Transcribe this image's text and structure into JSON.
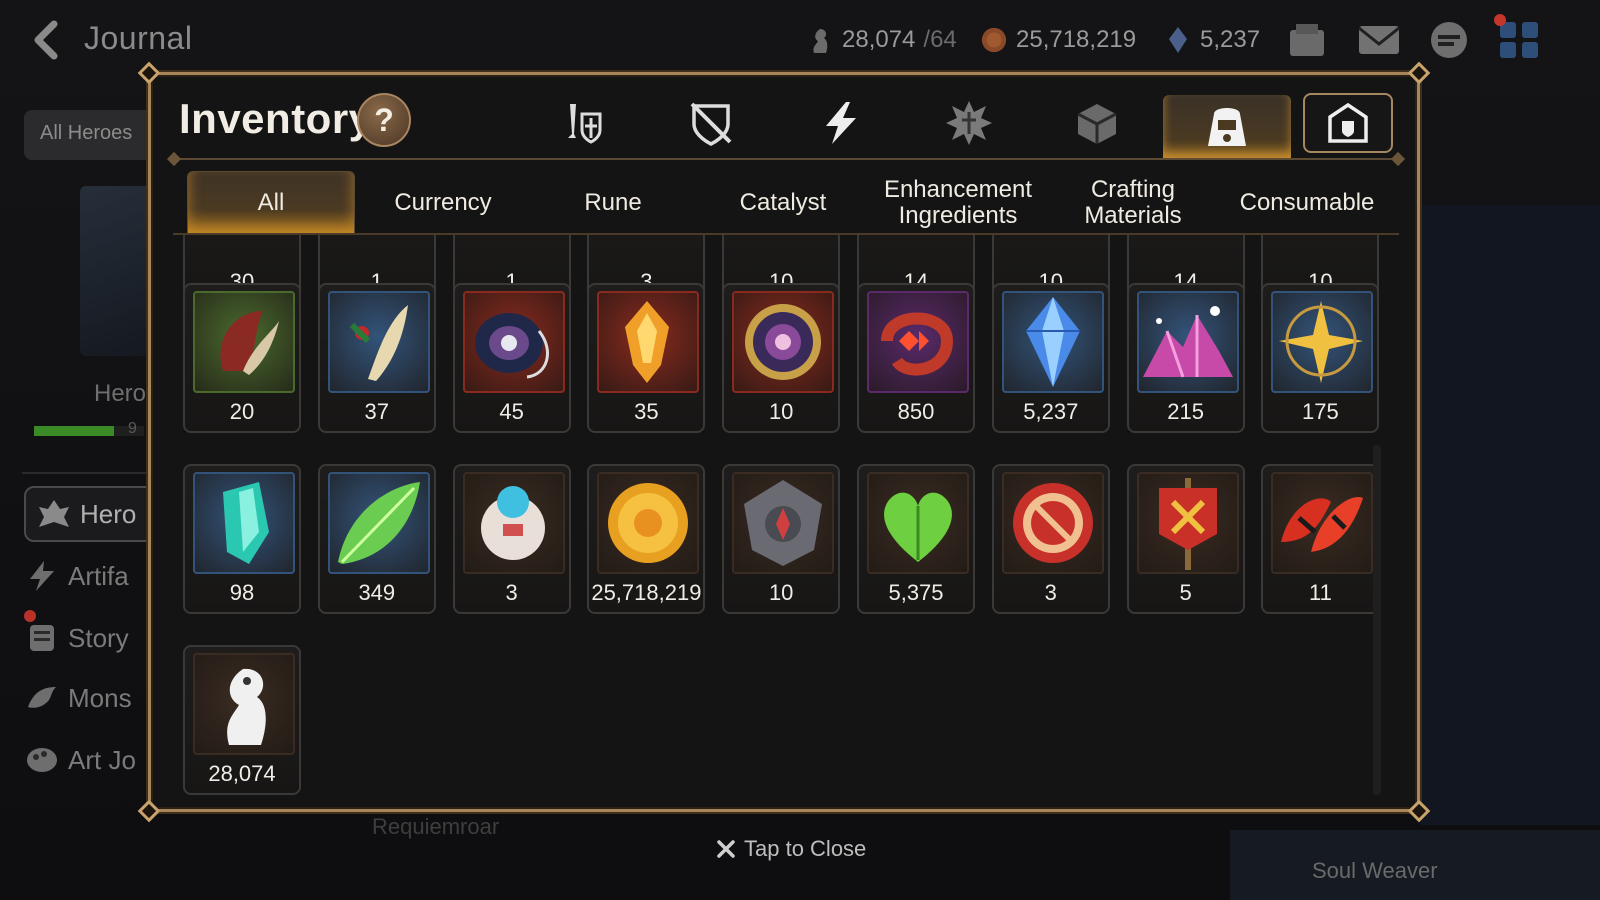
{
  "top_bar": {
    "title": "Journal",
    "skystone": "28,074",
    "skystone_cap": "/64",
    "gold": "25,718,219",
    "crystal": "5,237"
  },
  "left": {
    "filter": "All Heroes",
    "hero_caption": "Hero",
    "hero_bar_value": "9",
    "nav": [
      "Hero",
      "Artifa",
      "Story",
      "Mons",
      "Art Jo"
    ]
  },
  "modal": {
    "title": "Inventory",
    "help": "?",
    "category_tabs": [
      "weapon-armor-icon",
      "broken-shield-icon",
      "lightning-icon",
      "rune-crest-icon",
      "cube-icon",
      "bag-icon",
      "guild-shield-icon"
    ],
    "sub_tabs": [
      "All",
      "Currency",
      "Rune",
      "Catalyst",
      "Enhancement\nIngredients",
      "Crafting\nMaterials",
      "Consumable"
    ],
    "active_sub_tab": "All",
    "partial_row": [
      "30",
      "1",
      "1",
      "3",
      "10",
      "14",
      "10",
      "14",
      "10"
    ],
    "items": [
      {
        "icon": "claw-icon",
        "count": "20",
        "bg": "green"
      },
      {
        "icon": "feather-berry-icon",
        "count": "37",
        "bg": "blue"
      },
      {
        "icon": "crystal-disc-icon",
        "count": "45",
        "bg": "red"
      },
      {
        "icon": "flame-crystal-icon",
        "count": "35",
        "bg": "red"
      },
      {
        "icon": "ornate-orb-icon",
        "count": "10",
        "bg": "red"
      },
      {
        "icon": "red-charm-icon",
        "count": "850",
        "bg": "purple"
      },
      {
        "icon": "blue-crystal-icon",
        "count": "5,237",
        "bg": "blue"
      },
      {
        "icon": "pink-gem-pile-icon",
        "count": "215",
        "bg": "blue"
      },
      {
        "icon": "gold-star-amulet-icon",
        "count": "175",
        "bg": "blue"
      },
      {
        "icon": "teal-crystal-icon",
        "count": "98",
        "bg": "blue"
      },
      {
        "icon": "glowing-leaf-icon",
        "count": "349",
        "bg": "blue"
      },
      {
        "icon": "robot-bell-icon",
        "count": "3",
        "bg": "brown"
      },
      {
        "icon": "gold-coin-icon",
        "count": "25,718,219",
        "bg": "brown"
      },
      {
        "icon": "stone-compass-icon",
        "count": "10",
        "bg": "brown"
      },
      {
        "icon": "green-heart-leaf-icon",
        "count": "5,375",
        "bg": "brown"
      },
      {
        "icon": "red-seal-icon",
        "count": "3",
        "bg": "brown"
      },
      {
        "icon": "war-banner-icon",
        "count": "5",
        "bg": "brown"
      },
      {
        "icon": "red-leaves-icon",
        "count": "11",
        "bg": "brown"
      },
      {
        "icon": "knight-skystone-icon",
        "count": "28,074",
        "bg": "brown"
      }
    ]
  },
  "close_hint": "Tap to Close",
  "bottom_left": "Requiemroar",
  "bottom_right": "Soul Weaver",
  "colors": {
    "accent_gold": "#a8865a",
    "tab_glow": "#f0a83a",
    "bg_green": "#4a6a2e",
    "bg_blue": "#33547a",
    "bg_red": "#8a2a1e",
    "bg_purple": "#5a2a6a",
    "bg_brown": "#3a2c22"
  }
}
